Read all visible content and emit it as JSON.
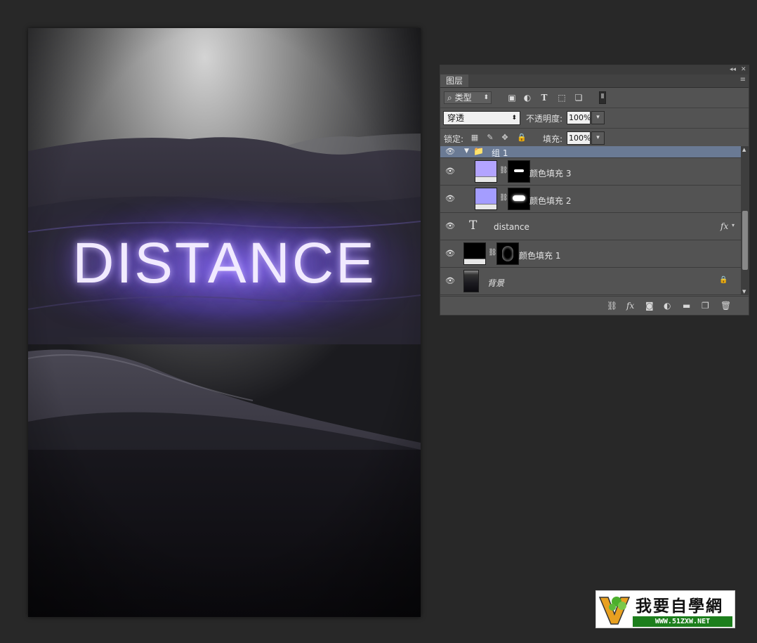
{
  "canvas": {
    "title_text": "DISTANCE"
  },
  "panel": {
    "tab_label": "图层",
    "collapse_icon": "◂◂",
    "close_icon": "✕",
    "menu_icon": "≡",
    "filter": {
      "kind_label": "类型",
      "icons": [
        "image-filter-icon",
        "adjustment-filter-icon",
        "type-filter-icon",
        "shape-filter-icon",
        "smart-object-filter-icon"
      ]
    },
    "blend_mode": "穿透",
    "opacity_label": "不透明度:",
    "opacity_value": "100%",
    "lock_label": "锁定:",
    "fill_label": "填充:",
    "fill_value": "100%",
    "layers": [
      {
        "name": "组 1",
        "kind": "group",
        "selected": true
      },
      {
        "name": "颜色填充 3",
        "kind": "fill",
        "color": "#b3a4ff",
        "indented": true
      },
      {
        "name": "颜色填充 2",
        "kind": "fill",
        "color": "#a49dff",
        "indented": true
      },
      {
        "name": "distance",
        "kind": "text",
        "fx": "fx"
      },
      {
        "name": "颜色填充 1",
        "kind": "fill",
        "color": "#000000"
      },
      {
        "name": "背景",
        "kind": "background"
      }
    ]
  },
  "watermark": {
    "title": "我要自學網",
    "url": "WWW.51ZXW.NET"
  },
  "colors": {
    "app_bg": "#282828",
    "panel_bg": "#535353",
    "selected_row": "#6a7a94",
    "glow": "#7b62f0"
  }
}
